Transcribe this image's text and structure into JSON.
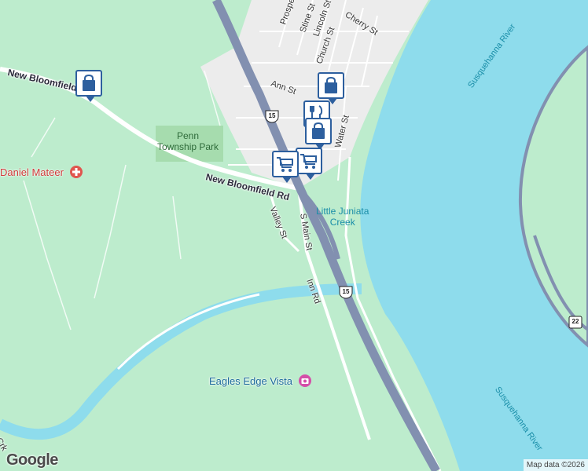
{
  "map": {
    "colors": {
      "land": "#bdeccd",
      "water": "#8edcec",
      "road": "#ffffff",
      "highway": "#8290b0",
      "town": "#ececec",
      "park": "#a6dcae"
    },
    "roads": {
      "new_bloomfield_1": "New Bloomfield Rd",
      "new_bloomfield_2": "New Bloomfield Rd",
      "prospect": "Prospect Av",
      "stine": "Stine St",
      "lincoln": "Lincoln St",
      "cherry": "Cherry St",
      "church": "Church St",
      "ann": "Ann St",
      "water": "Water St",
      "valley": "Valley St",
      "main": "S Main St",
      "inn": "Inn Rd",
      "manns_crk": "Sherman's Crk"
    },
    "water_labels": {
      "susquehanna_top": "Susquehanna River",
      "susquehanna_bottom": "Susquehanna River",
      "little_juniata": "Little Juniata\nCreek"
    },
    "places": {
      "park": "Penn\nTownship Park",
      "doctor": "Daniel Mateer",
      "vista": "Eagles Edge Vista"
    },
    "shields": {
      "us15_a": "15",
      "us15_b": "15",
      "pa22": "22"
    },
    "markers": [
      {
        "name": "shopping-bag-marker-west",
        "icon": "shopping-bag-icon"
      },
      {
        "name": "shopping-bag-marker-town-1",
        "icon": "shopping-bag-icon"
      },
      {
        "name": "restaurant-marker",
        "icon": "fork-knife-icon"
      },
      {
        "name": "shopping-bag-marker-town-2",
        "icon": "shopping-bag-icon"
      },
      {
        "name": "shopping-cart-marker-1",
        "icon": "shopping-cart-icon"
      },
      {
        "name": "shopping-cart-marker-2",
        "icon": "shopping-cart-icon"
      }
    ],
    "branding": {
      "logo": "Google",
      "attribution": "Map data ©2026"
    }
  }
}
